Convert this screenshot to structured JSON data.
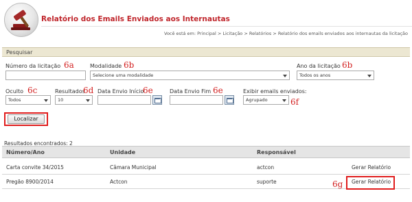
{
  "header": {
    "title": "Relatório dos Emails Enviados aos Internautas",
    "breadcrumb": "Você está em: Principal > Licitação > Relatórios > Relatório dos emails enviados aos internautas da licitação"
  },
  "search_panel": {
    "heading": "Pesquisar",
    "fields": {
      "numero": {
        "label": "Número da licitação",
        "value": "",
        "annotation": "6a"
      },
      "modalidade": {
        "label": "Modalidade",
        "value": "Selecione uma modalidade",
        "annotation": "6b"
      },
      "ano": {
        "label": "Ano da licitação",
        "value": "Todos os anos",
        "annotation": "6b"
      },
      "oculto": {
        "label": "Oculto",
        "value": "Todos",
        "annotation": "6c"
      },
      "resultados": {
        "label": "Resultados",
        "value": "10",
        "annotation": "6d"
      },
      "data_inicio": {
        "label": "Data Envio Início",
        "value": "",
        "annotation": "6e"
      },
      "data_fim": {
        "label": "Data Envio Fim",
        "value": "",
        "annotation": "6e"
      },
      "exibir": {
        "label": "Exibir emails enviados:",
        "value": "Agrupado",
        "annotation": "6f"
      }
    },
    "localizar_label": "Localizar"
  },
  "results": {
    "count_text": "Resultados encontrados: 2",
    "columns": [
      "Número/Ano",
      "Unidade",
      "Responsável"
    ],
    "rows": [
      {
        "numero": "Carta convite 34/2015",
        "unidade": "Câmara Municipal",
        "responsavel": "actcon",
        "action": "Gerar Relatório"
      },
      {
        "numero": "Pregão 8900/2014",
        "unidade": "Actcon",
        "responsavel": "suporte",
        "action": "Gerar Relatório"
      }
    ],
    "action_annotation": "6g"
  },
  "colors": {
    "title": "#c0272d",
    "annotation": "#d21f1f",
    "panel_head": "#ece7d2",
    "table_head": "#e5e5e5"
  },
  "icons": [
    "gavel-logo-icon",
    "calendar-icon",
    "chevron-down-icon"
  ]
}
